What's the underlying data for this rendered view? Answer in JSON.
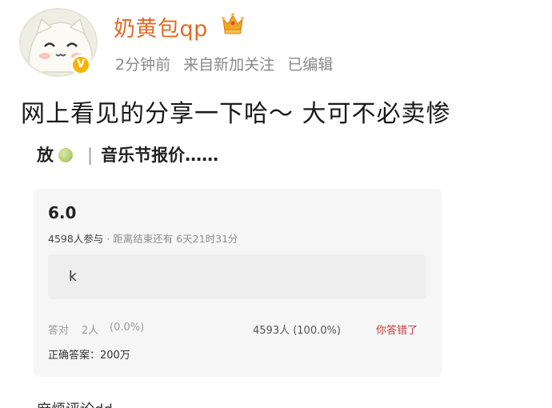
{
  "post": {
    "username": "奶黄包qp",
    "meta": {
      "time": "2分钟前",
      "source": "来自新加关注",
      "edited": "已编辑"
    },
    "text": "网上看见的分享一下哈～ 大可不必卖惨",
    "badge": "V"
  },
  "screenshot": {
    "title_start": "放",
    "separator": "|",
    "title_end": "音乐节报价……",
    "card": {
      "score": "6.0",
      "participants": "4598人参与",
      "deadline": "· 距离结束还有 6天21时31分",
      "answer": "k",
      "right_label": "答对",
      "right_count": "2人",
      "right_pct": "(0.0%)",
      "wrong_stat": "4593人 (100.0%)",
      "wrong_flag": "你答错了",
      "correct_answer": "正确答案：200万"
    },
    "comment_cut": "麻烦评论dd"
  },
  "colors": {
    "username": "#e06a26",
    "badge": "#f6b400",
    "wrong_flag": "#c53b3b"
  },
  "icons": [
    "avatar-cat-icon",
    "verified-badge-icon",
    "crown-icon",
    "green-ball-emoji-icon"
  ]
}
